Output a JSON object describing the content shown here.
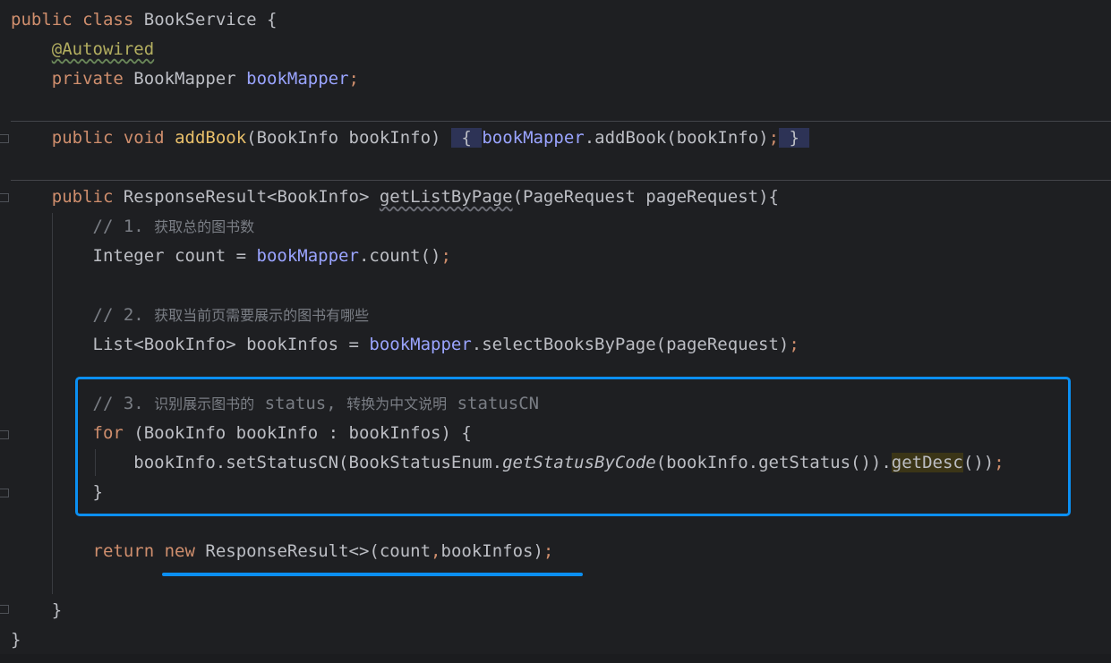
{
  "code": {
    "l1": {
      "kw1": "public",
      "kw2": "class",
      "name": "BookService",
      "brace": "{"
    },
    "l2": {
      "annotation": "@Autowired"
    },
    "l3": {
      "kw": "private",
      "type": "BookMapper",
      "field": "bookMapper",
      "semi": ";"
    },
    "l4": {
      "kw1": "public",
      "kw2": "void",
      "fn": "addBook",
      "params": "(BookInfo bookInfo)",
      "ob": "{",
      "field": "bookMapper",
      "call": ".addBook(bookInfo)",
      "semi": ";",
      "cb": "}"
    },
    "l5": {
      "kw": "public",
      "type": "ResponseResult<BookInfo>",
      "fn": "getListByPage",
      "params": "(PageRequest pageRequest){"
    },
    "l6": {
      "prefix": "// 1. ",
      "text": "获取总的图书数"
    },
    "l7": {
      "type": "Integer count = ",
      "field": "bookMapper",
      "call": ".count()",
      "semi": ";"
    },
    "l8": {
      "prefix": "// 2. ",
      "text": "获取当前页需要展示的图书有哪些"
    },
    "l9": {
      "type": "List<BookInfo> bookInfos = ",
      "field": "bookMapper",
      "call": ".selectBooksByPage(pageRequest)",
      "semi": ";"
    },
    "l10": {
      "prefix": "// 3. ",
      "text1": "识别展示图书的",
      "mid": " status, ",
      "text2": "转换为中文说明",
      "end": " statusCN"
    },
    "l11": {
      "kw": "for",
      "rest": " (BookInfo bookInfo : bookInfos) {"
    },
    "l12": {
      "a": "bookInfo.setStatusCN(BookStatusEnum.",
      "static": "getStatusByCode",
      "b": "(bookInfo.getStatus()).",
      "desc": "getDesc",
      "c": "())",
      "semi": ";"
    },
    "l13": {
      "brace": "}"
    },
    "l14": {
      "kw1": "return",
      "kw2": "new",
      "rest": " ResponseResult<>(count",
      "comma": ",",
      "rest2": "bookInfos)",
      "semi": ";"
    },
    "l15": {
      "brace": "}"
    },
    "l16": {
      "brace": "}"
    }
  },
  "colors": {
    "highlight_box": "#0b8ff2",
    "background": "#1e1f22"
  }
}
